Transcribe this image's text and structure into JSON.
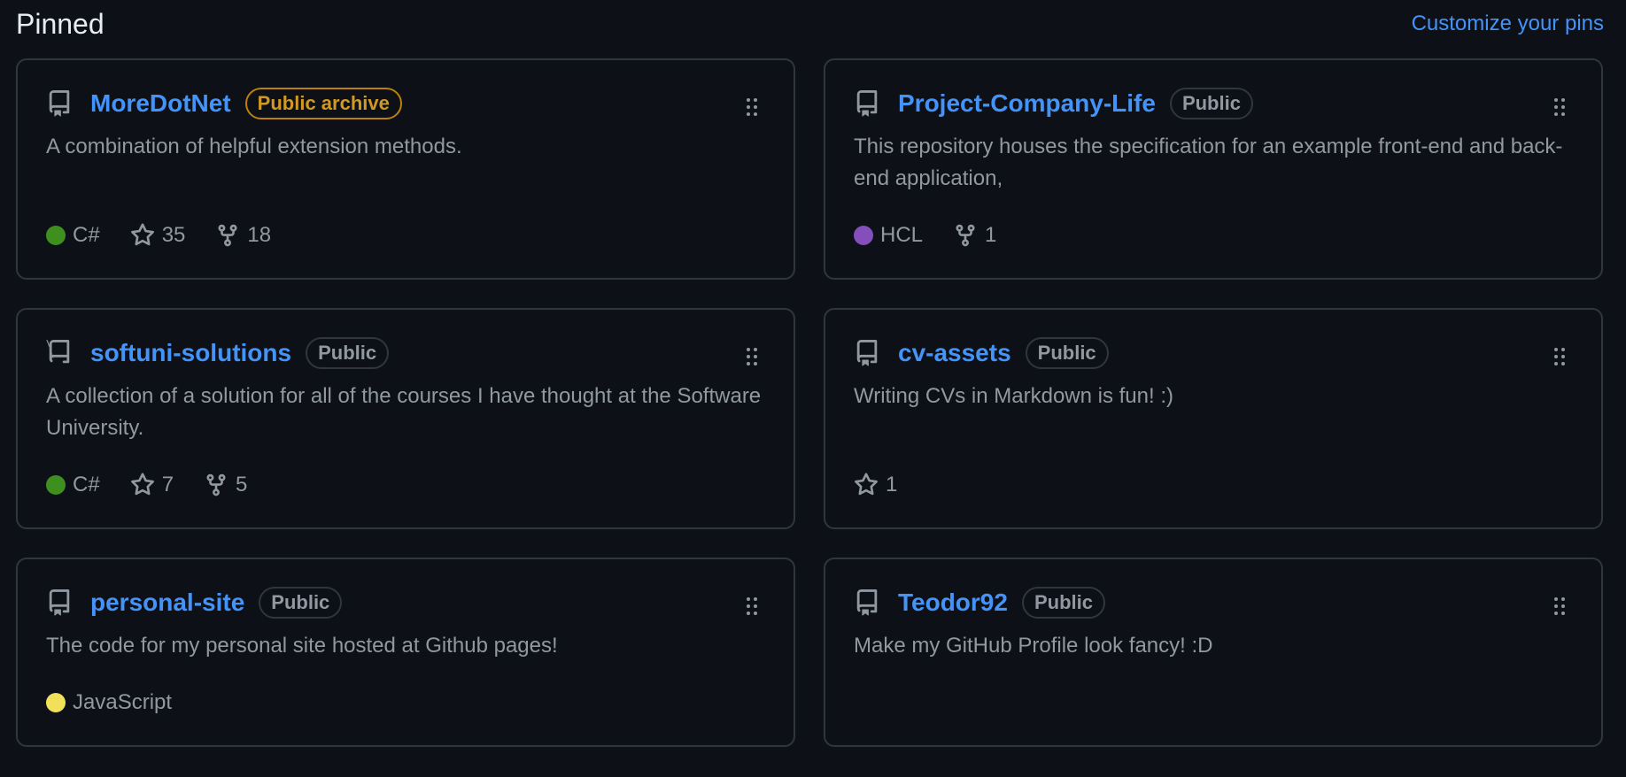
{
  "header": {
    "title": "Pinned",
    "customize_label": "Customize your pins"
  },
  "colors": {
    "link": "#4493f8",
    "archive": "#d29922",
    "csharp": "#178600",
    "hcl": "#844fba",
    "javascript": "#f1e05a"
  },
  "repos": [
    {
      "name": "MoreDotNet",
      "badge": "Public archive",
      "description": "A combination of helpful extension methods.",
      "language": "C#",
      "stars": "35",
      "forks": "18"
    },
    {
      "name": "Project-Company-Life",
      "badge": "Public",
      "description": "This repository houses the specification for an example front-end and back-end application,",
      "language": "HCL",
      "forks": "1"
    },
    {
      "name": "softuni-solutions",
      "badge": "Public",
      "description": "A collection of a solution for all of the courses I have thought at the Software University.",
      "language": "C#",
      "stars": "7",
      "forks": "5"
    },
    {
      "name": "cv-assets",
      "badge": "Public",
      "description": "Writing CVs in Markdown is fun! :)",
      "stars": "1"
    },
    {
      "name": "personal-site",
      "badge": "Public",
      "description": "The code for my personal site hosted at Github pages!",
      "language": "JavaScript"
    },
    {
      "name": "Teodor92",
      "badge": "Public",
      "description": "Make my GitHub Profile look fancy! :D"
    }
  ]
}
